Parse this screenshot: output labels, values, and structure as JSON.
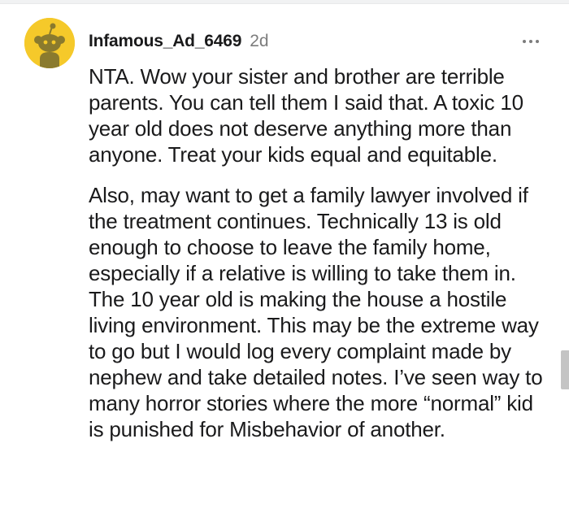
{
  "comment": {
    "username": "Infamous_Ad_6469",
    "time": "2d",
    "paragraphs": [
      "NTA. Wow your sister and brother are terrible parents. You can tell them I said that. A toxic 10 year old does not deserve anything more than anyone. Treat your kids equal and equitable.",
      "Also, may want to get a family lawyer involved if the treatment continues. Technically 13 is old enough to choose to leave the family home, especially if a relative is willing to take them in. The 10 year old is making the house a hostile living environment. This may be the extreme way to go but I would log every complaint made by nephew and take detailed notes. I’ve seen way to many horror stories where the more “normal” kid is punished for Misbehavior of another."
    ]
  },
  "avatar": {
    "icon": "snoo-avatar-icon",
    "background_color": "#f5c92a"
  },
  "more_options": {
    "icon": "more-options-icon"
  }
}
